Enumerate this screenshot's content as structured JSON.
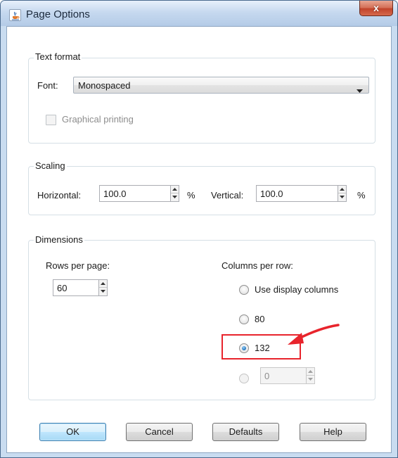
{
  "window": {
    "title": "Page Options",
    "close_glyph": "x",
    "icon": "java-cup-icon"
  },
  "text_format": {
    "group_label": "Text format",
    "font_label": "Font:",
    "font_value": "Monospaced",
    "graphical_printing_label": "Graphical printing",
    "graphical_printing_checked": false,
    "graphical_printing_enabled": false
  },
  "scaling": {
    "group_label": "Scaling",
    "horizontal_label": "Horizontal:",
    "horizontal_value": "100.0",
    "horizontal_unit": "%",
    "vertical_label": "Vertical:",
    "vertical_value": "100.0",
    "vertical_unit": "%"
  },
  "dimensions": {
    "group_label": "Dimensions",
    "rows_label": "Rows per page:",
    "rows_value": "60",
    "columns_label": "Columns per row:",
    "column_options": [
      {
        "label": "Use display columns",
        "checked": false
      },
      {
        "label": "80",
        "checked": false
      },
      {
        "label": "132",
        "checked": true
      }
    ],
    "custom_columns_value": "0",
    "custom_enabled": false
  },
  "buttons": {
    "ok": "OK",
    "cancel": "Cancel",
    "defaults": "Defaults",
    "help": "Help"
  },
  "annotation": {
    "highlight_color": "#e8242c",
    "arrow_color": "#e8242c"
  }
}
